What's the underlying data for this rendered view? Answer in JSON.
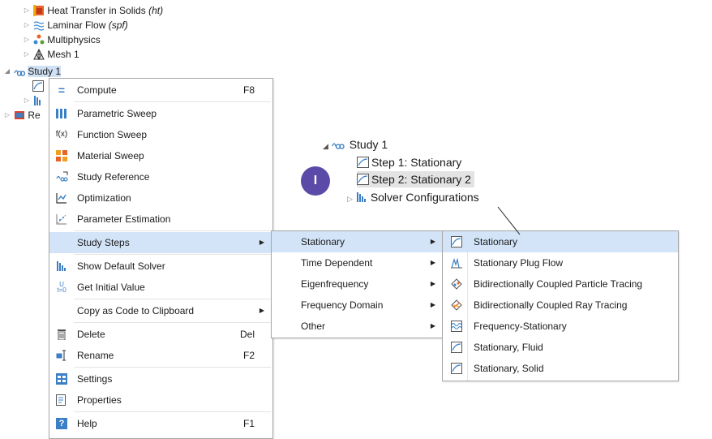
{
  "tree": {
    "heat_transfer": {
      "label": "Heat Transfer in Solids",
      "tag": "(ht)"
    },
    "laminar_flow": {
      "label": "Laminar Flow",
      "tag": "(spf)"
    },
    "multiphysics": "Multiphysics",
    "mesh": "Mesh 1",
    "study": "Study 1",
    "results_partial": "Re"
  },
  "context_menu": {
    "items": [
      {
        "label": "Compute",
        "shortcut": "F8",
        "icon": "compute-icon"
      },
      {
        "label": "Parametric Sweep",
        "icon": "parametric-sweep-icon"
      },
      {
        "label": "Function Sweep",
        "icon": "function-sweep-icon"
      },
      {
        "label": "Material Sweep",
        "icon": "material-sweep-icon"
      },
      {
        "label": "Study Reference",
        "icon": "study-reference-icon"
      },
      {
        "label": "Optimization",
        "icon": "optimization-icon"
      },
      {
        "label": "Parameter Estimation",
        "icon": "parameter-estimation-icon"
      },
      {
        "label": "Study Steps",
        "submenu": true
      },
      {
        "label": "Show Default Solver",
        "icon": "solver-icon"
      },
      {
        "label": "Get Initial Value",
        "icon": "initial-value-icon"
      },
      {
        "label": "Copy as Code to Clipboard",
        "submenu": true
      },
      {
        "label": "Delete",
        "shortcut": "Del",
        "icon": "delete-icon"
      },
      {
        "label": "Rename",
        "shortcut": "F2",
        "icon": "rename-icon"
      },
      {
        "label": "Settings",
        "icon": "settings-icon"
      },
      {
        "label": "Properties",
        "icon": "properties-icon"
      },
      {
        "label": "Help",
        "shortcut": "F1",
        "icon": "help-icon"
      }
    ]
  },
  "study_steps_menu": {
    "items": [
      "Stationary",
      "Time Dependent",
      "Eigenfrequency",
      "Frequency Domain",
      "Other"
    ]
  },
  "stationary_menu": {
    "items": [
      "Stationary",
      "Stationary Plug Flow",
      "Bidirectionally Coupled Particle Tracing",
      "Bidirectionally Coupled Ray Tracing",
      "Frequency-Stationary",
      "Stationary, Fluid",
      "Stationary, Solid"
    ]
  },
  "right_tree": {
    "study": "Study 1",
    "step1": "Step 1: Stationary",
    "step2": "Step 2: Stationary 2",
    "solver": "Solver Configurations"
  },
  "badge": "I",
  "colors": {
    "selected": "#d3e4f8",
    "badge": "#5b4aa8",
    "study_icon": "#3b7fc4"
  }
}
